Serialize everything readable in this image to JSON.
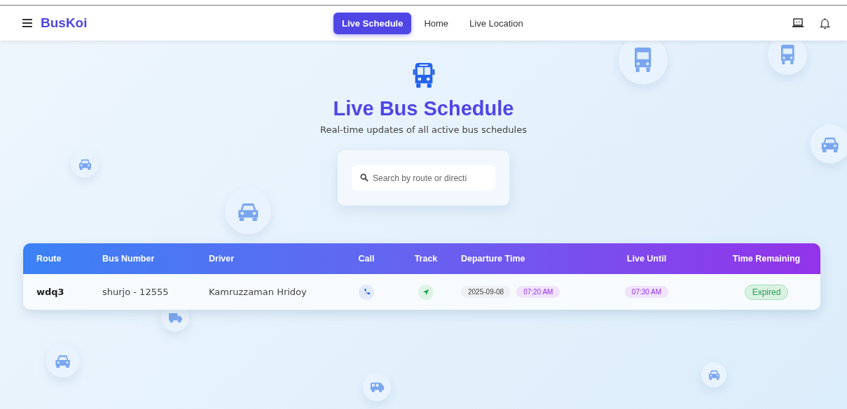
{
  "brand": "BusKoi",
  "nav": [
    {
      "label": "Live Schedule",
      "selected": true
    },
    {
      "label": "Home",
      "selected": false
    },
    {
      "label": "Live Location",
      "selected": false
    }
  ],
  "hero": {
    "title": "Live Bus Schedule",
    "subtitle": "Real-time updates of all active bus schedules"
  },
  "search": {
    "placeholder": "Search by route or directi"
  },
  "table": {
    "columns": [
      "Route",
      "Bus Number",
      "Driver",
      "Call",
      "Track",
      "Departure Time",
      "Live Until",
      "Time Remaining"
    ],
    "rows": [
      {
        "route": "wdq3",
        "bus_number": "shurjo - 12555",
        "driver": "Kamruzzaman Hridoy",
        "departure_date": "2025-09-08",
        "departure_time": "07:20 AM",
        "live_until": "07:30 AM",
        "time_remaining": "Expired"
      }
    ]
  }
}
